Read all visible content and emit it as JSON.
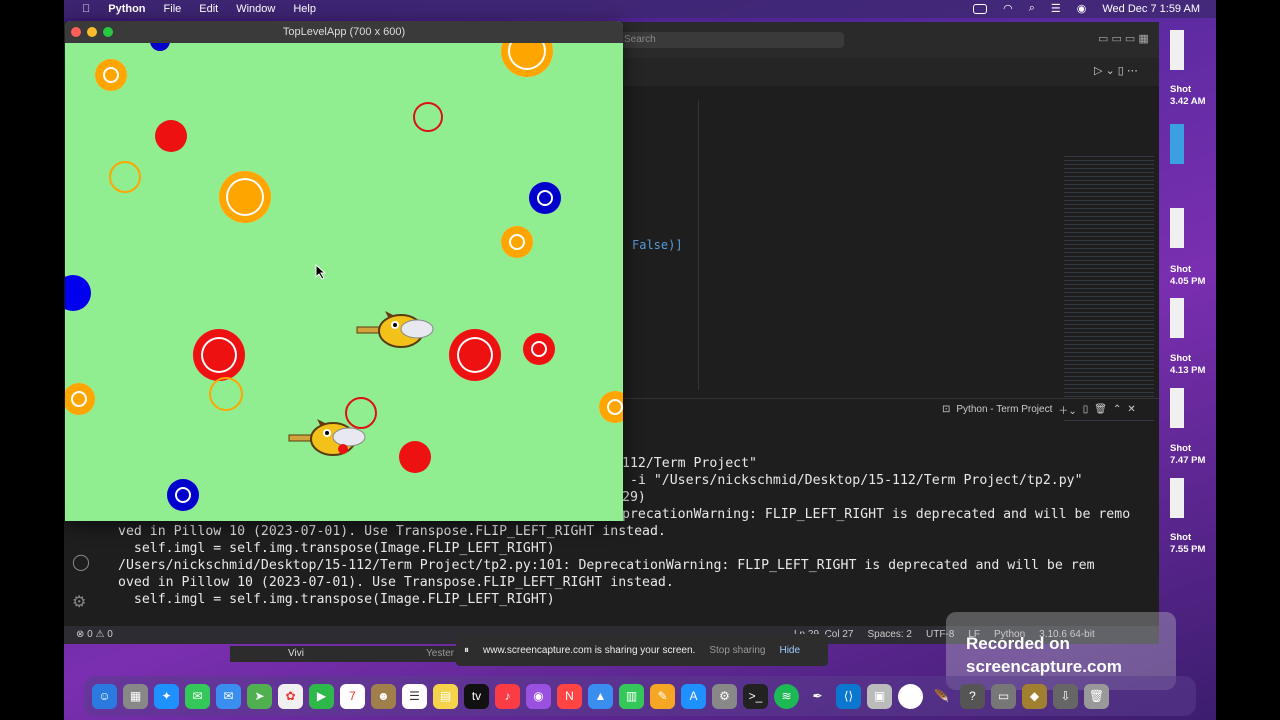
{
  "menubar": {
    "apple": "",
    "app": "Python",
    "items": [
      "File",
      "Edit",
      "Window",
      "Help"
    ],
    "datetime": "Wed Dec 7  1:59 AM"
  },
  "vscode": {
    "search_placeholder": "Search",
    "code_fragment": "False)]",
    "terminal_title": "Python - Term Project",
    "terminal_lines": [
      "112/Term Project\"",
      "-i \"/Users/nickschmid/Desktop/15-112/Term Project/tp2.py\"",
      "29)",
      "precationWarning: FLIP_LEFT_RIGHT is deprecated and will be remo",
      "ved in Pillow 10 (2023-07-01). Use Transpose.FLIP_LEFT_RIGHT instead.",
      "  self.imgl = self.img.transpose(Image.FLIP_LEFT_RIGHT)",
      "/Users/nickschmid/Desktop/15-112/Term Project/tp2.py:101: DeprecationWarning: FLIP_LEFT_RIGHT is deprecated and will be rem",
      "oved in Pillow 10 (2023-07-01). Use Transpose.FLIP_LEFT_RIGHT instead.",
      "  self.imgl = self.img.transpose(Image.FLIP_LEFT_RIGHT)"
    ],
    "status_left": "⊗ 0 ⚠ 0",
    "status_right": [
      "Ln 29, Col 27",
      "Spaces: 2",
      "UTF-8",
      "LF",
      "Python",
      "3.10.6 64-bit"
    ]
  },
  "game_window": {
    "title": "TopLevelApp (700 x 600)"
  },
  "desktop_shots": [
    {
      "title": "Shot",
      "time": "3.42 AM"
    },
    {
      "title": "Shot",
      "time": "4.05 PM"
    },
    {
      "title": "Shot",
      "time": "4.13 PM"
    },
    {
      "title": "Shot",
      "time": "7.47 PM"
    },
    {
      "title": "Shot",
      "time": "7.55 PM"
    }
  ],
  "notification": {
    "text": "www.screencapture.com is sharing your screen.",
    "stop": "Stop sharing",
    "hide": "Hide"
  },
  "lowbar": {
    "name": "Vivi",
    "when": "Yester"
  },
  "recorded": {
    "line1": "Recorded on",
    "line2": "screencapture.com"
  },
  "colors": {
    "game_bg": "#90ee90",
    "red": "#ee1111",
    "orange": "#ffa500",
    "blue": "#0000cc"
  }
}
